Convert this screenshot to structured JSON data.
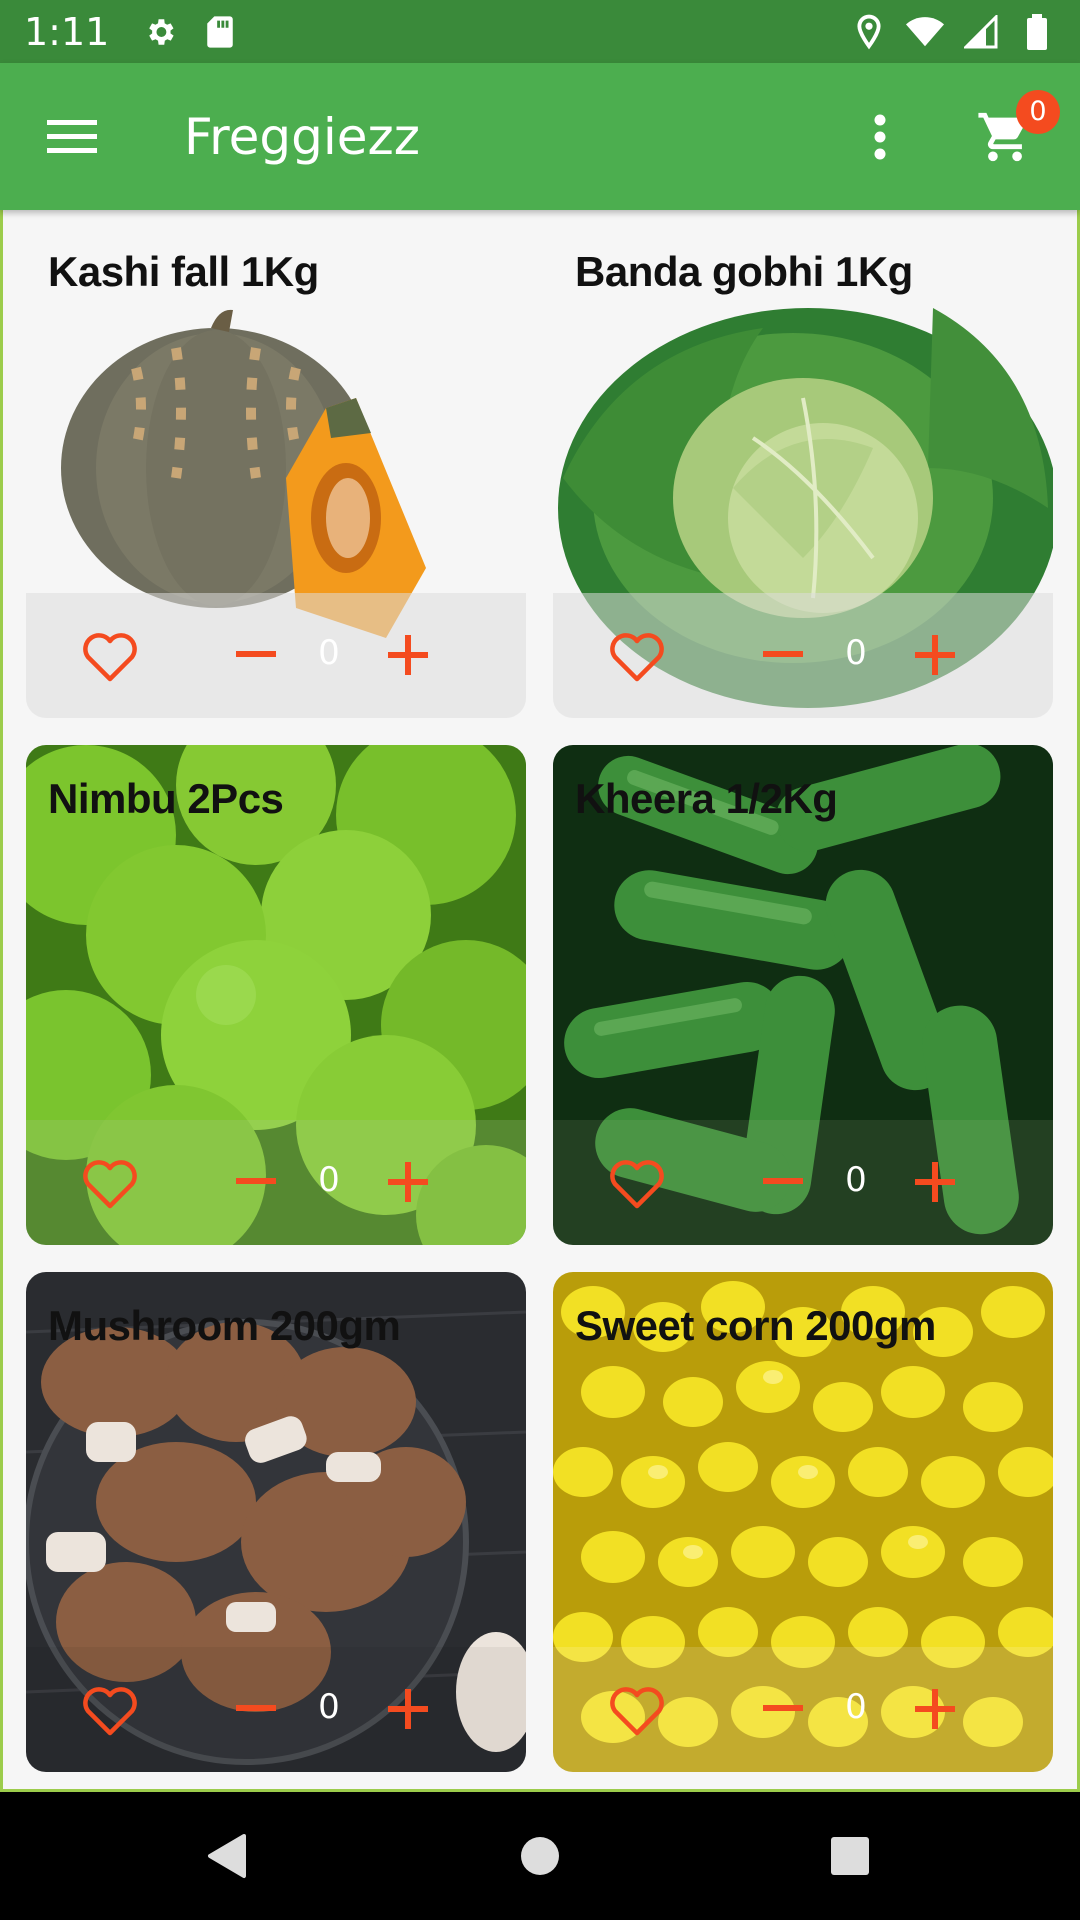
{
  "status_bar": {
    "time": "1:11",
    "icons": [
      "gear-icon",
      "sd-card-icon",
      "location-icon",
      "wifi-icon",
      "signal-icon",
      "battery-icon"
    ]
  },
  "app_bar": {
    "title": "Freggiezz",
    "cart_count": "0",
    "icons": [
      "menu-icon",
      "more-vert-icon",
      "cart-icon"
    ],
    "color": "#4cae4f"
  },
  "products": [
    {
      "name": "Kashi fall 1Kg",
      "qty": "0",
      "image": "pumpkin"
    },
    {
      "name": "Banda gobhi 1Kg",
      "qty": "0",
      "image": "cabbage"
    },
    {
      "name": "Nimbu 2Pcs",
      "qty": "0",
      "image": "limes"
    },
    {
      "name": "Kheera 1/2Kg",
      "qty": "0",
      "image": "cucumbers"
    },
    {
      "name": "Mushroom 200gm",
      "qty": "0",
      "image": "mushrooms"
    },
    {
      "name": "Sweet corn 200gm",
      "qty": "0",
      "image": "sweet-corn"
    }
  ],
  "accent_color": "#f44b1f",
  "nav_bar": {
    "icons": [
      "back-icon",
      "home-icon",
      "recent-apps-icon"
    ]
  }
}
